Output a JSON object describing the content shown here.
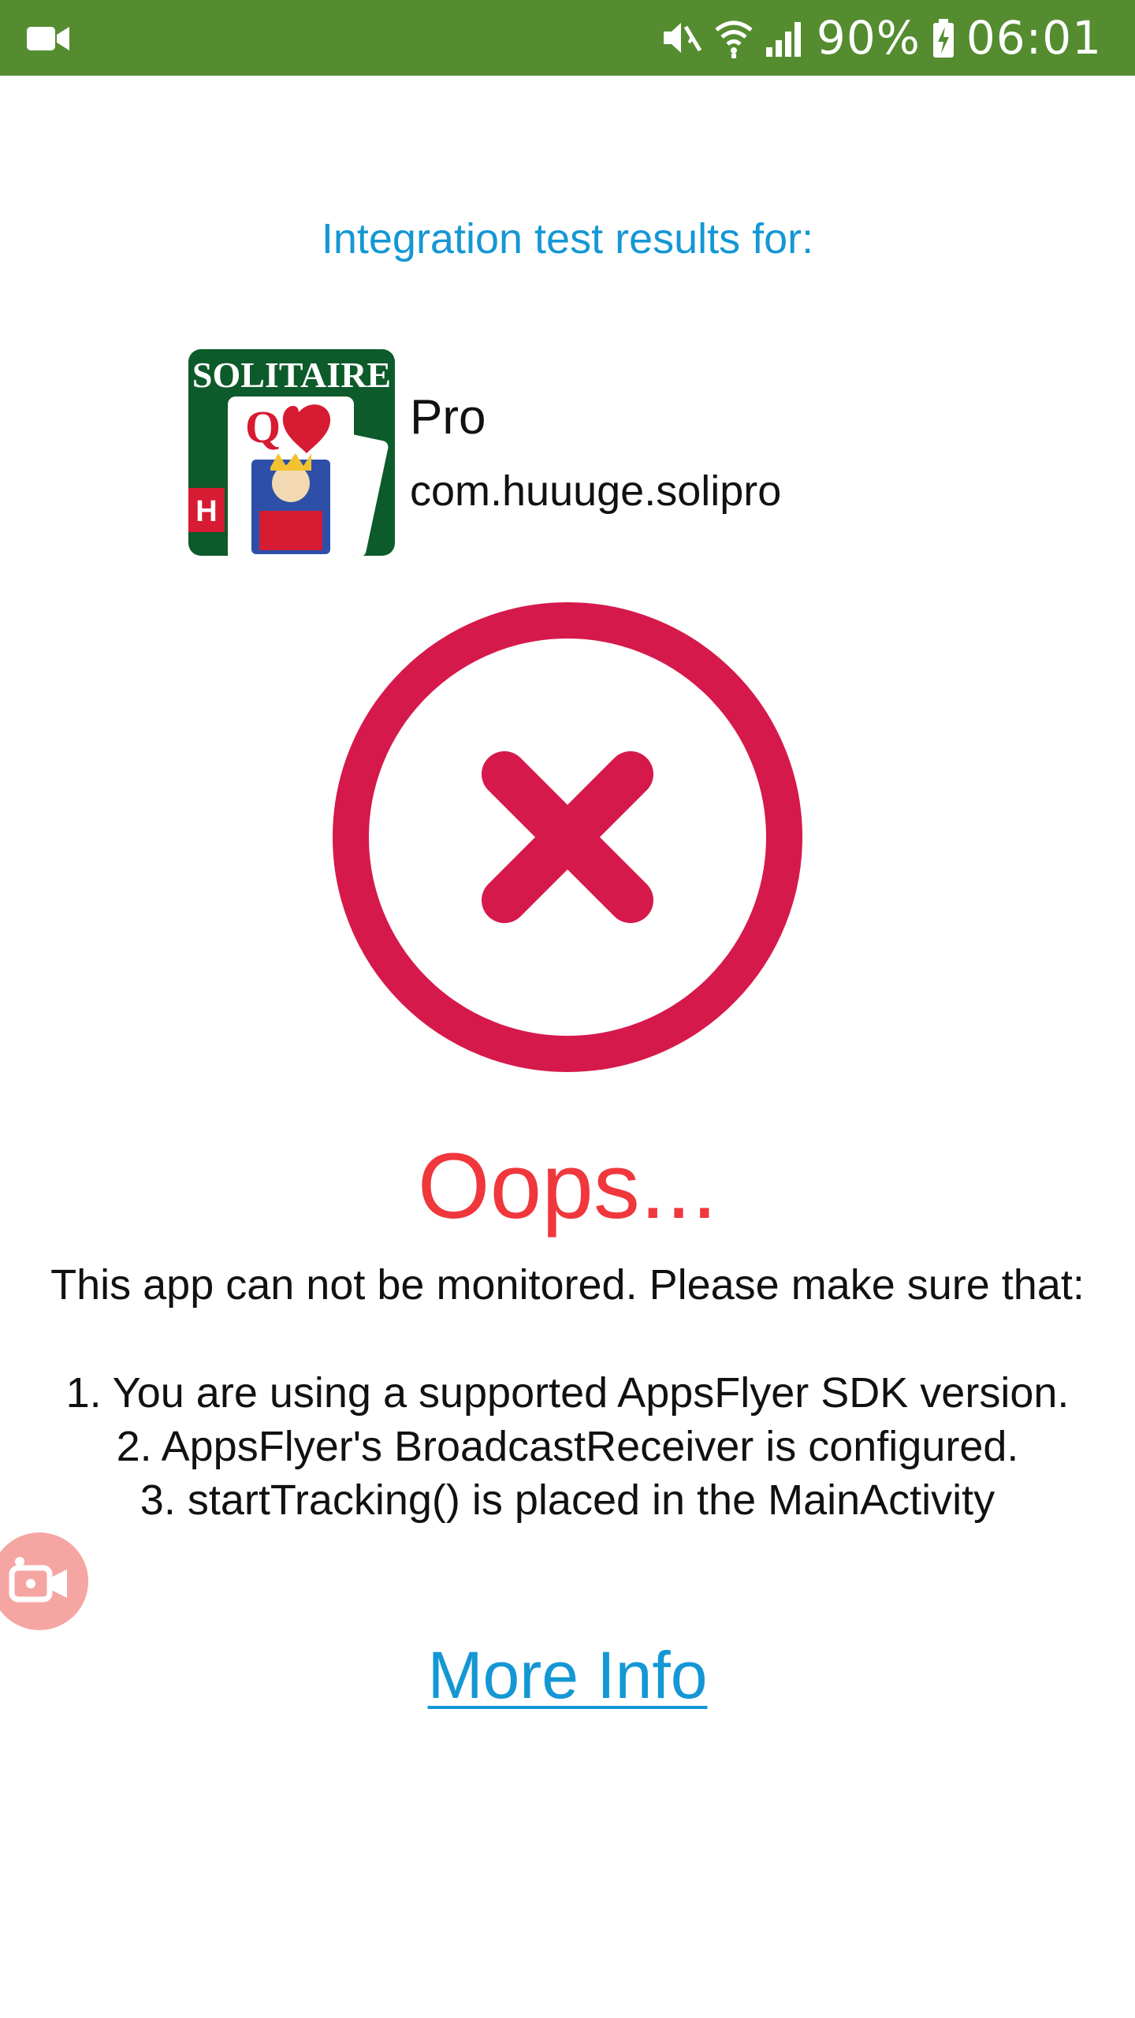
{
  "status_bar": {
    "left_icon": "video-camera-icon",
    "icons": [
      "mute-vibrate-icon",
      "wifi-icon",
      "signal-icon"
    ],
    "battery_percent": "90%",
    "battery_icon": "battery-charging-icon",
    "time": "06:01",
    "background_color": "#548c2f"
  },
  "heading": "Integration test results for:",
  "app": {
    "icon": "solitaire-app-icon",
    "icon_text": "SOLITAIRE",
    "name": "Pro",
    "package": "com.huuuge.solipro"
  },
  "result": {
    "icon": "error-x-circle-icon",
    "color": "#d6194b",
    "title": "Oops...",
    "message": "This app can not be monitored. Please make sure that:",
    "steps": [
      "1. You are using a supported AppsFlyer SDK version.",
      "2. AppsFlyer's BroadcastReceiver is configured.",
      "3. startTracking() is placed in the MainActivity"
    ]
  },
  "recorder": {
    "icon": "screen-recorder-icon"
  },
  "more_info_link": "More Info"
}
